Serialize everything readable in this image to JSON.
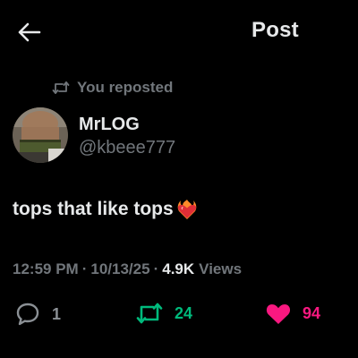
{
  "header": {
    "title": "Post"
  },
  "repost_banner": {
    "text": "You reposted"
  },
  "author": {
    "display_name": "MrLOG",
    "handle": "@kbeee777"
  },
  "post": {
    "text": "tops that like tops"
  },
  "meta": {
    "time": "12:59 PM",
    "separator": "·",
    "date": "10/13/25",
    "views_count": "4.9K",
    "views_label": "Views"
  },
  "actions": {
    "reply_count": "1",
    "repost_count": "24",
    "like_count": "94"
  },
  "colors": {
    "background": "#000000",
    "text": "#e7e9ea",
    "muted": "#71767b",
    "repost_active": "#00ba7c",
    "like_active": "#f91880"
  },
  "icons": {
    "back": "arrow-left-icon",
    "repost_banner": "repost-icon",
    "reply": "reply-bubble-icon",
    "repost": "repost-icon",
    "like": "heart-filled-icon",
    "emoji": "heart-on-fire-emoji"
  }
}
